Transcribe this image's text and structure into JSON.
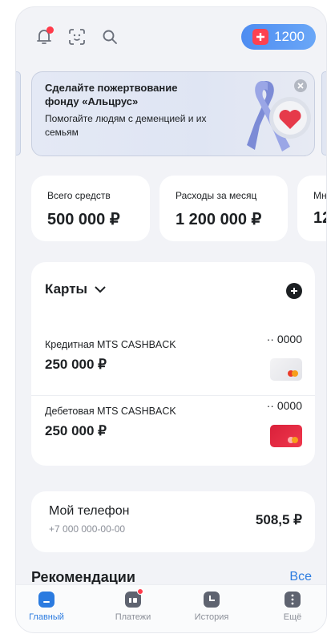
{
  "topbar": {
    "icons": [
      "bell-icon",
      "scan-icon",
      "search-icon"
    ],
    "points_value": "1200"
  },
  "promo": {
    "title": "Сделайте пожертвование фонду «Альцрус»",
    "text": "Помогайте людям с деменцией и их семьям"
  },
  "balances": [
    {
      "label": "Всего средств",
      "value": "500 000 ₽"
    },
    {
      "label": "Расходы за месяц",
      "value": "1 200 000 ₽"
    },
    {
      "label": "Мн",
      "value": "12"
    }
  ],
  "cards": {
    "title": "Карты",
    "items": [
      {
        "name": "Кредитная MTS CASHBACK",
        "amount": "250 000 ₽",
        "last4": "·· 0000"
      },
      {
        "name": "Дебетовая MTS CASHBACK",
        "amount": "250 000 ₽",
        "last4": "·· 0000"
      }
    ]
  },
  "phone": {
    "title": "Мой телефон",
    "number": "+7 000 000-00-00",
    "balance": "508,5 ₽"
  },
  "recommendations": {
    "title": "Рекомендации",
    "all_label": "Все"
  },
  "nav": {
    "items": [
      {
        "label": "Главный",
        "icon": "home-icon",
        "active": true
      },
      {
        "label": "Платежи",
        "icon": "payments-icon"
      },
      {
        "label": "История",
        "icon": "history-icon"
      },
      {
        "label": "Ещё",
        "icon": "more-icon"
      }
    ]
  },
  "colors": {
    "accent": "#2b7be0",
    "notification": "#ff3b4b",
    "points_button": "#5a98f4"
  }
}
